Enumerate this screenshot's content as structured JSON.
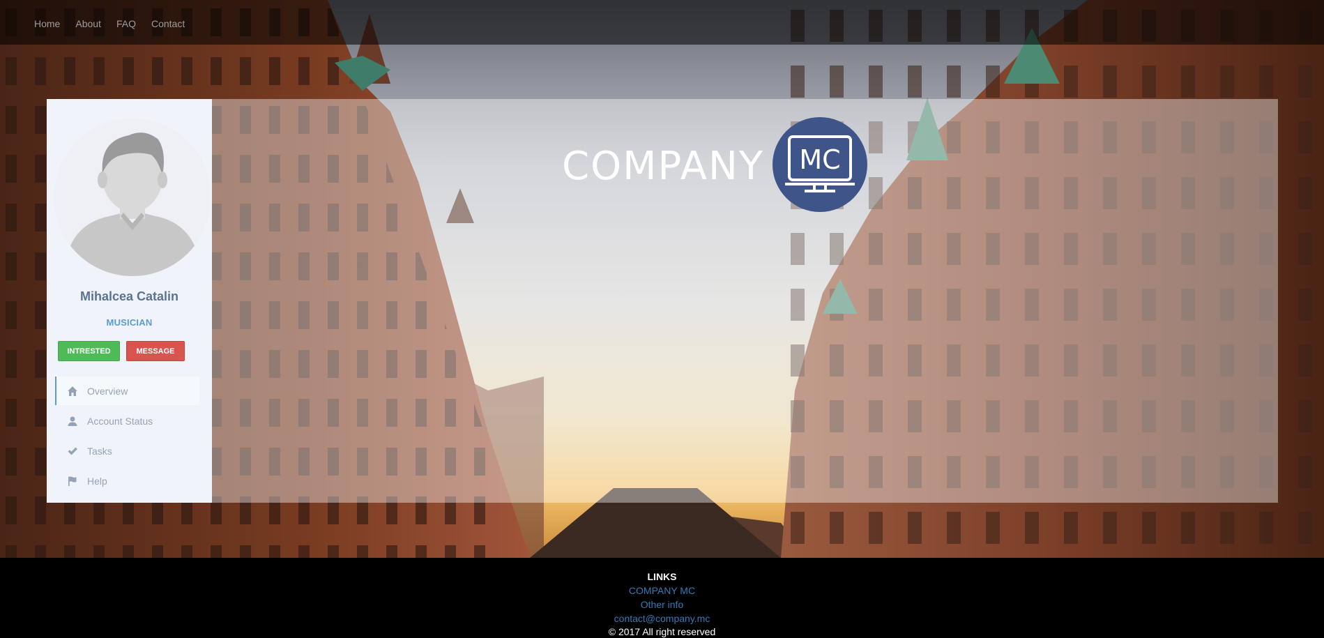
{
  "nav": {
    "items": [
      {
        "label": "Home"
      },
      {
        "label": "About"
      },
      {
        "label": "FAQ"
      },
      {
        "label": "Contact"
      }
    ]
  },
  "profile": {
    "name": "Mihalcea Catalin",
    "job": "MUSICIAN",
    "buttons": {
      "interested": "INTRESTED",
      "message": "MESSAGE"
    },
    "menu": [
      {
        "label": "Overview",
        "icon": "home-icon",
        "active": true
      },
      {
        "label": "Account Status",
        "icon": "user-icon",
        "active": false
      },
      {
        "label": "Tasks",
        "icon": "check-icon",
        "active": false
      },
      {
        "label": "Help",
        "icon": "flag-icon",
        "active": false
      }
    ]
  },
  "logo": {
    "text": "COMPANY",
    "badge": "MC"
  },
  "footer": {
    "title": "LINKS",
    "links": [
      {
        "label": "COMPANY MC"
      },
      {
        "label": "Other info"
      },
      {
        "label": "contact@company.mc"
      }
    ],
    "copyright": "© 2017 All right reserved"
  },
  "colors": {
    "accent": "#5b9bd1",
    "name": "#5a7391",
    "green_button": "#4fbb58",
    "red_button": "#d9534f",
    "logo_circle": "#3f5488",
    "link": "#337ab7"
  }
}
